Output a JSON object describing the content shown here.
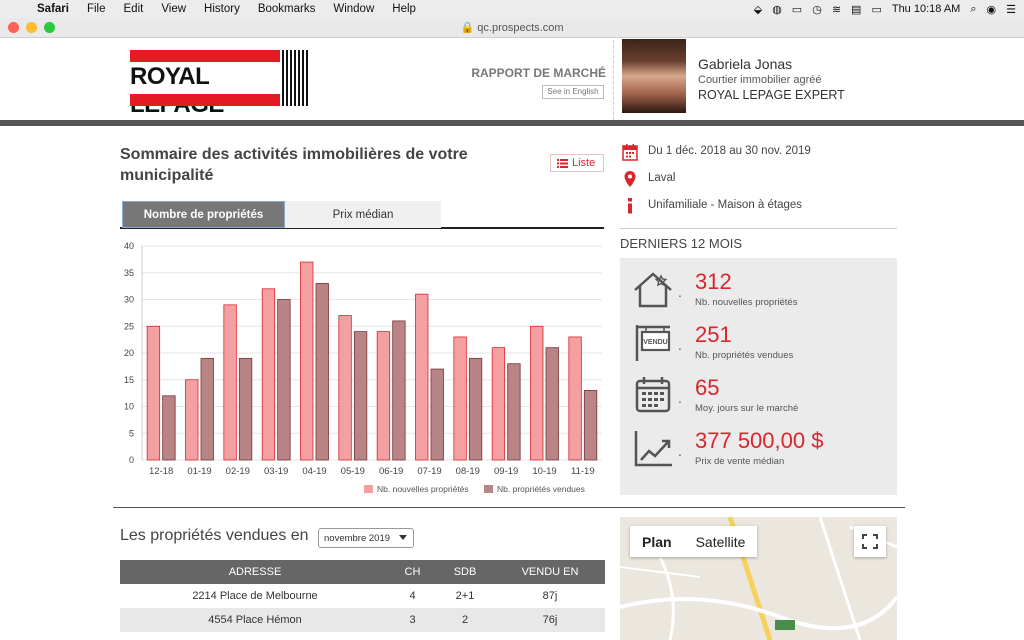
{
  "menubar": {
    "app": "Safari",
    "menus": [
      "File",
      "Edit",
      "View",
      "History",
      "Bookmarks",
      "Window",
      "Help"
    ],
    "clock": "Thu 10:18 AM"
  },
  "browser": {
    "url": "qc.prospects.com"
  },
  "header": {
    "logo_text": "ROYAL LEPAGE",
    "report_title": "RAPPORT DE MARCHÉ",
    "see_english": "See in English",
    "agent": {
      "name": "Gabriela Jonas",
      "title": "Courtier immobilier agréé",
      "agency": "ROYAL LEPAGE EXPERT"
    }
  },
  "summary": {
    "title": "Sommaire des activités immobilières de votre municipalité",
    "list_button": "Liste",
    "tabs": [
      "Nombre de propriétés",
      "Prix médian"
    ]
  },
  "chart_data": {
    "type": "bar",
    "categories": [
      "12-18",
      "01-19",
      "02-19",
      "03-19",
      "04-19",
      "05-19",
      "06-19",
      "07-19",
      "08-19",
      "09-19",
      "10-19",
      "11-19"
    ],
    "series": [
      {
        "name": "Nb. nouvelles propriétés",
        "values": [
          25,
          15,
          29,
          32,
          37,
          27,
          24,
          31,
          23,
          21,
          25,
          23
        ],
        "color": "#f4a0a3"
      },
      {
        "name": "Nb. propriétés vendues",
        "values": [
          12,
          19,
          19,
          30,
          33,
          24,
          26,
          17,
          19,
          18,
          21,
          13
        ],
        "color": "#b88486"
      }
    ],
    "ylim": [
      0,
      40
    ],
    "yticks": [
      0,
      5,
      10,
      15,
      20,
      25,
      30,
      35,
      40
    ],
    "grid": true,
    "legend": "bottom-right"
  },
  "filters": {
    "period": "Du 1 déc. 2018 au 30 nov. 2019",
    "city": "Laval",
    "property_type": "Unifamiliale - Maison à étages"
  },
  "stats": {
    "heading": "DERNIERS 12 MOIS",
    "sign_text": "VENDU",
    "items": [
      {
        "value": "312",
        "label": "Nb. nouvelles propriétés",
        "icon": "house-star-icon"
      },
      {
        "value": "251",
        "label": "Nb. propriétés vendues",
        "icon": "sold-sign-icon"
      },
      {
        "value": "65",
        "label": "Moy. jours sur le marché",
        "icon": "calendar-icon"
      },
      {
        "value": "377 500,00 $",
        "label": "Prix de vente médian",
        "icon": "trend-chart-icon"
      }
    ]
  },
  "sold": {
    "title": "Les propriétés vendues en",
    "month_select": "novembre 2019",
    "columns": [
      "ADRESSE",
      "CH",
      "SDB",
      "VENDU EN"
    ],
    "rows": [
      [
        "2214 Place de Melbourne",
        "4",
        "2+1",
        "87j"
      ],
      [
        "4554 Place Hémon",
        "3",
        "2",
        "76j"
      ]
    ]
  },
  "map": {
    "tabs": [
      "Plan",
      "Satellite"
    ]
  },
  "colors": {
    "brand_red": "#e31c23",
    "accent_red": "#d9262c"
  }
}
